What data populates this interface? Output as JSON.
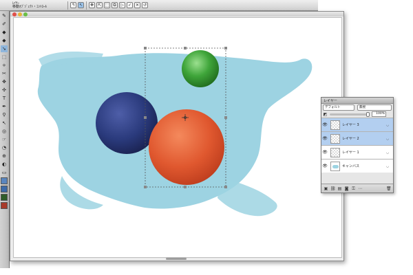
{
  "propbar": {
    "tool_line1": "ﾚｲﾔｰ",
    "tool_line2": "移動ｵﾌﾞｼﾞｪｸﾄ・ｺﾝﾄﾛｰﾙ",
    "buttons": [
      {
        "icon": "move-layer-icon"
      },
      {
        "icon": "select-arrow-icon"
      },
      {
        "icon": "align-icon"
      },
      {
        "icon": "arrange-icon"
      },
      {
        "icon": "transform-icon"
      },
      {
        "icon": "distort-icon"
      },
      {
        "icon": "play-icon"
      },
      {
        "icon": "commit-icon"
      },
      {
        "icon": "cancel-icon"
      },
      {
        "icon": "reset-icon"
      }
    ]
  },
  "tools": [
    "✎",
    "✐",
    "◆",
    "◆",
    "➘",
    "⬚",
    "⟡",
    "✂",
    "✥",
    "✣",
    "T",
    "✒",
    "⚲",
    "↖",
    "◎",
    "☞",
    "◔",
    "⊕",
    "◐",
    "▭"
  ],
  "colors": {
    "background": "#ffffff",
    "blue_paint": "#9dd3e2",
    "navy_ball": "#2a3a7c",
    "orange_ball": "#e0582f",
    "green_ball": "#3fa53a",
    "selection_accent": "#b3cff0",
    "brand_swatches": [
      "#5a86bf",
      "#3d6aa8",
      "#2f5d2a",
      "#a83a2a"
    ]
  },
  "layers_panel": {
    "title": "レイヤー",
    "composite_method": "デフォルト",
    "preserve": "無視",
    "opacity": "100%",
    "opacity_value": 1.0,
    "layers": [
      {
        "name": "レイヤー 3",
        "visible": true,
        "selected": true,
        "type": "layer"
      },
      {
        "name": "レイヤー 2",
        "visible": true,
        "selected": true,
        "type": "layer"
      },
      {
        "name": "レイヤー 1",
        "visible": true,
        "selected": false,
        "type": "layer"
      },
      {
        "name": "キャンバス",
        "visible": true,
        "selected": false,
        "type": "canvas"
      }
    ]
  }
}
